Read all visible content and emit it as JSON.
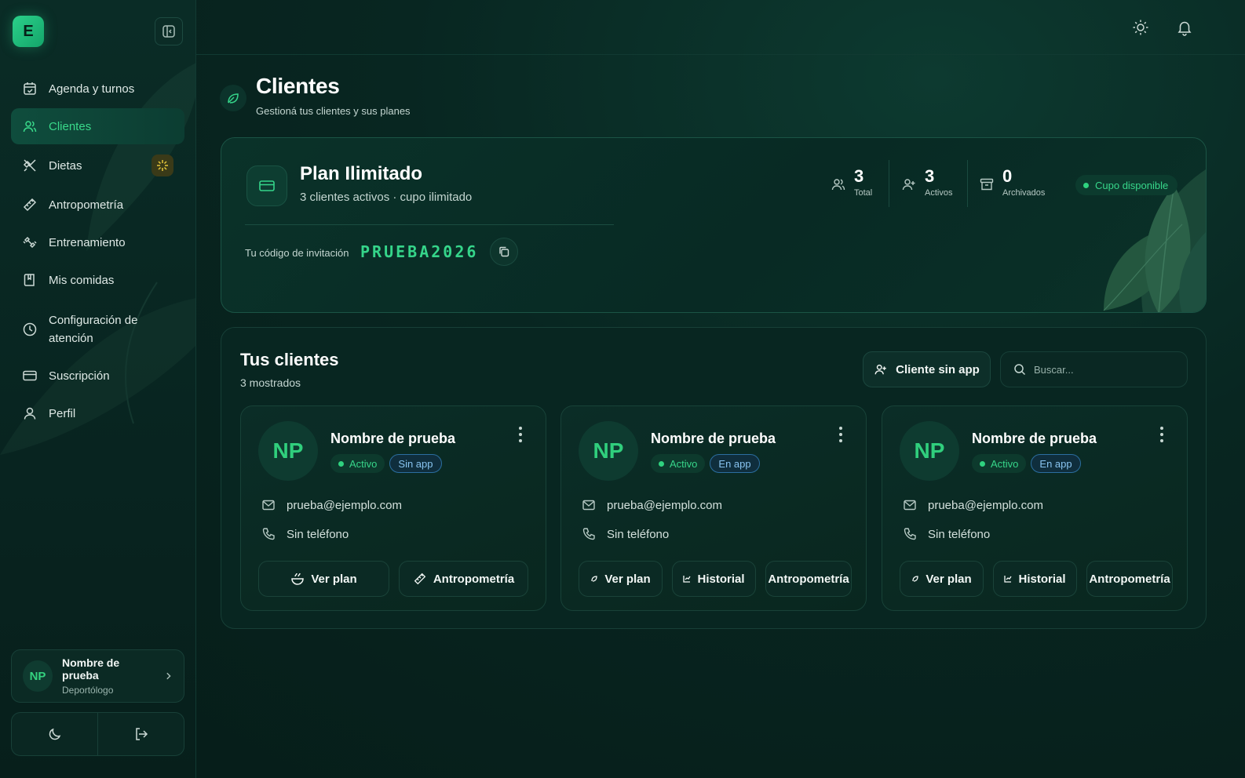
{
  "brand": {
    "logo_letter": "E"
  },
  "sidebar": {
    "items": [
      {
        "label": "Agenda y turnos",
        "icon": "calendar-check-icon"
      },
      {
        "label": "Clientes",
        "icon": "users-icon",
        "active": true
      },
      {
        "label": "Dietas",
        "icon": "utensils-icon"
      },
      {
        "label": "Antropometría",
        "icon": "ruler-icon"
      },
      {
        "label": "Entrenamiento",
        "icon": "dumbbell-icon"
      },
      {
        "label": "Mis comidas",
        "icon": "book-icon"
      },
      {
        "label": "Configuración de atención",
        "icon": "clock-icon"
      },
      {
        "label": "Suscripción",
        "icon": "credit-card-icon"
      },
      {
        "label": "Perfil",
        "icon": "user-icon"
      }
    ],
    "user": {
      "initials": "NP",
      "name": "Nombre de prueba",
      "role": "Deportólogo"
    }
  },
  "header": {
    "title": "Clientes",
    "subtitle": "Gestioná tus clientes y sus planes"
  },
  "plan": {
    "title": "Plan Ilimitado",
    "subtitle": "3 clientes activos · cupo ilimitado",
    "invite_label": "Tu código de invitación",
    "invite_code": "PRUEBA2026",
    "stats": [
      {
        "value": "3",
        "label": "Total"
      },
      {
        "value": "3",
        "label": "Activos"
      },
      {
        "value": "0",
        "label": "Archivados"
      }
    ],
    "status": "Cupo disponible"
  },
  "clients": {
    "title": "Tus clientes",
    "count_label": "3 mostrados",
    "add_button": "Cliente sin app",
    "search_placeholder": "Buscar...",
    "cards": [
      {
        "initials": "NP",
        "name": "Nombre de prueba",
        "status": "Activo",
        "app": "Sin app",
        "email": "prueba@ejemplo.com",
        "phone": "Sin teléfono",
        "actions": [
          "Ver plan",
          "Antropometría"
        ]
      },
      {
        "initials": "NP",
        "name": "Nombre de prueba",
        "status": "Activo",
        "app": "En app",
        "email": "prueba@ejemplo.com",
        "phone": "Sin teléfono",
        "actions": [
          "Ver plan",
          "Historial",
          "Antropometría"
        ]
      },
      {
        "initials": "NP",
        "name": "Nombre de prueba",
        "status": "Activo",
        "app": "En app",
        "email": "prueba@ejemplo.com",
        "phone": "Sin teléfono",
        "actions": [
          "Ver plan",
          "Historial",
          "Antropometría"
        ]
      }
    ]
  },
  "colors": {
    "accent": "#35d58a",
    "background": "#07201c",
    "app_badge": "#88c4f0"
  }
}
